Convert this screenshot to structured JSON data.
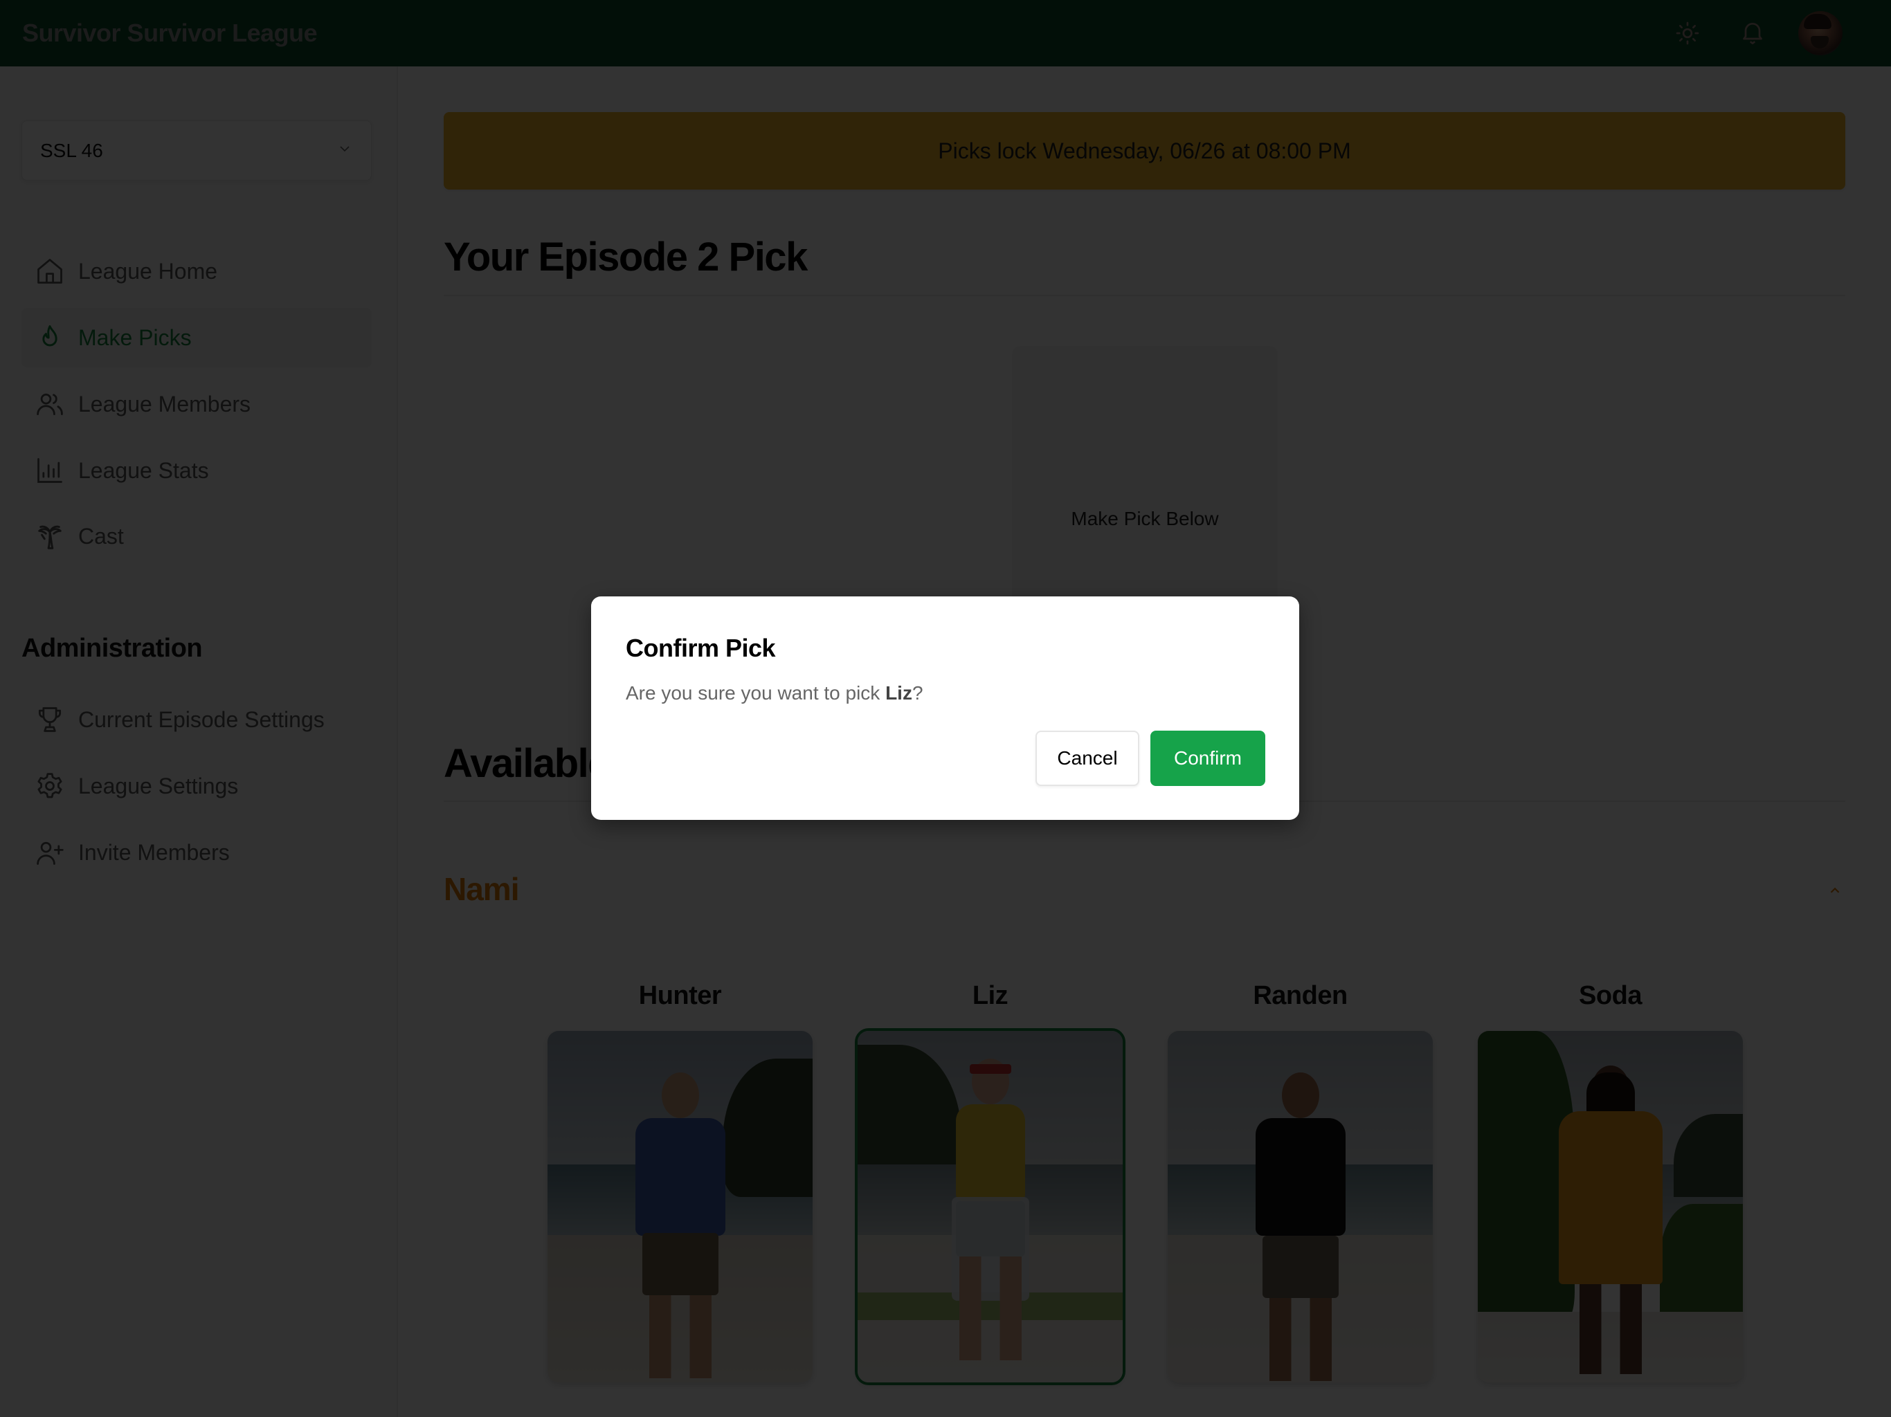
{
  "header": {
    "app_title": "Survivor Survivor League",
    "icons": {
      "theme_toggle": "sun-icon",
      "notifications": "bell-icon",
      "avatar": "user-avatar"
    }
  },
  "sidebar": {
    "league_select": {
      "value": "SSL 46",
      "icon": "chevron-down-icon"
    },
    "nav_items": [
      {
        "label": "League Home",
        "icon": "home-icon",
        "active": false
      },
      {
        "label": "Make Picks",
        "icon": "flame-icon",
        "active": true
      },
      {
        "label": "League Members",
        "icon": "users-icon",
        "active": false
      },
      {
        "label": "League Stats",
        "icon": "bar-chart-icon",
        "active": false
      },
      {
        "label": "Cast",
        "icon": "palm-tree-icon",
        "active": false
      }
    ],
    "admin_heading": "Administration",
    "admin_items": [
      {
        "label": "Current Episode Settings",
        "icon": "trophy-icon"
      },
      {
        "label": "League Settings",
        "icon": "gear-icon"
      },
      {
        "label": "Invite Members",
        "icon": "user-plus-icon"
      }
    ]
  },
  "main": {
    "lock_banner": "Picks lock Wednesday, 06/26 at 08:00 PM",
    "pick_section_title": "Your Episode 2 Pick",
    "pick_placeholder": "Make Pick Below",
    "available_section_title": "Available Castaways",
    "tribe": {
      "name": "Nami",
      "color": "#d97706",
      "collapse_icon": "chevron-up-icon",
      "castaways": [
        {
          "name": "Hunter",
          "selected": false
        },
        {
          "name": "Liz",
          "selected": true
        },
        {
          "name": "Randen",
          "selected": false
        },
        {
          "name": "Soda",
          "selected": false
        }
      ]
    }
  },
  "modal": {
    "title": "Confirm Pick",
    "body_prefix": "Are you sure you want to pick ",
    "body_name": "Liz",
    "body_suffix": "?",
    "cancel_label": "Cancel",
    "confirm_label": "Confirm"
  },
  "colors": {
    "header_bg": "#0b4d2a",
    "accent_green": "#15803d",
    "confirm_green": "#16a34a",
    "banner_amber": "#f0b429",
    "tribe_orange": "#d97706"
  }
}
